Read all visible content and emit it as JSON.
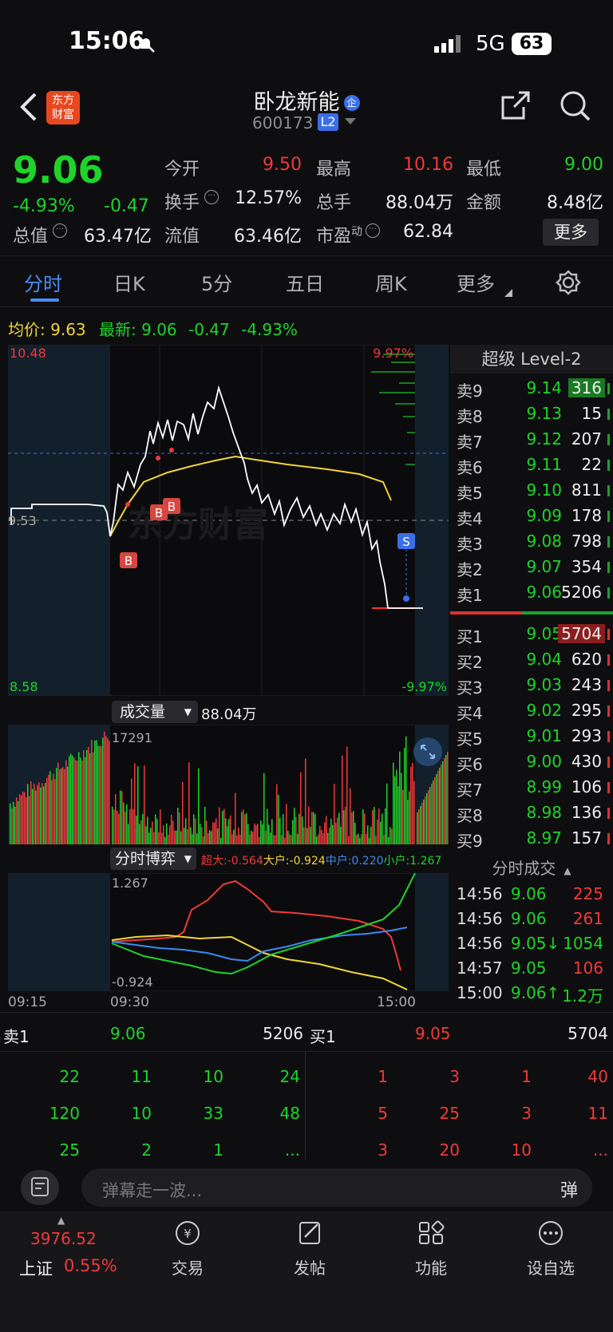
{
  "status_bar": {
    "time": "15:06",
    "network": "5G",
    "battery": "63"
  },
  "header": {
    "stock_name": "卧龙新能",
    "tag": "企",
    "code": "600173",
    "level": "L2",
    "logo_line1": "东方",
    "logo_line2": "财富"
  },
  "quote": {
    "price": "9.06",
    "change_pct": "-4.93%",
    "change": "-0.47",
    "open_label": "今开",
    "open": "9.50",
    "high_label": "最高",
    "high": "10.16",
    "low_label": "最低",
    "low": "9.00",
    "turnover_label": "换手",
    "turnover": "12.57%",
    "volume_label": "总手",
    "volume": "88.04万",
    "amount_label": "金额",
    "amount": "8.48亿",
    "mktcap_label": "总值",
    "mktcap": "63.47亿",
    "float_label": "流值",
    "float_cap": "63.46亿",
    "pe_label": "市盈",
    "pe_sup": "动",
    "pe": "62.84",
    "more_button": "更多"
  },
  "tabs": [
    "分时",
    "日K",
    "5分",
    "五日",
    "周K",
    "更多"
  ],
  "avg_line": {
    "avg_label": "均价:",
    "avg": "9.63",
    "latest_label": "最新:",
    "latest": "9.06",
    "chg": "-0.47",
    "pct": "-4.93%"
  },
  "chart": {
    "y_high": "10.48",
    "y_low": "8.58",
    "pct_high": "9.97%",
    "pct_low": "-9.97%",
    "mid_label": "9.53",
    "watermark": "东方财富",
    "vol_selector": "成交量",
    "vol_total": "88.04万",
    "vol_max": "17291",
    "game_selector": "分时博弈",
    "game_legend": [
      {
        "label": "超大:-0.564",
        "color": "#f0393a"
      },
      {
        "label": "大户:-0.924",
        "color": "#f0d43a"
      },
      {
        "label": "中户:0.220",
        "color": "#3a8af0"
      },
      {
        "label": "小户:1.267",
        "color": "#1ed42a"
      }
    ],
    "game_max": "1.267",
    "game_min": "-0.924",
    "time_labels": [
      "09:15",
      "09:30",
      "15:00"
    ],
    "markers": [
      "B",
      "B",
      "B",
      "S"
    ]
  },
  "level2": {
    "title": "超级 Level-2",
    "asks": [
      {
        "label": "卖9",
        "price": "9.14",
        "vol": "316"
      },
      {
        "label": "卖8",
        "price": "9.13",
        "vol": "15"
      },
      {
        "label": "卖7",
        "price": "9.12",
        "vol": "207"
      },
      {
        "label": "卖6",
        "price": "9.11",
        "vol": "22"
      },
      {
        "label": "卖5",
        "price": "9.10",
        "vol": "811"
      },
      {
        "label": "卖4",
        "price": "9.09",
        "vol": "178"
      },
      {
        "label": "卖3",
        "price": "9.08",
        "vol": "798"
      },
      {
        "label": "卖2",
        "price": "9.07",
        "vol": "354"
      },
      {
        "label": "卖1",
        "price": "9.06",
        "vol": "5206"
      }
    ],
    "bids": [
      {
        "label": "买1",
        "price": "9.05",
        "vol": "5704"
      },
      {
        "label": "买2",
        "price": "9.04",
        "vol": "620"
      },
      {
        "label": "买3",
        "price": "9.03",
        "vol": "243"
      },
      {
        "label": "买4",
        "price": "9.02",
        "vol": "295"
      },
      {
        "label": "买5",
        "price": "9.01",
        "vol": "293"
      },
      {
        "label": "买6",
        "price": "9.00",
        "vol": "430"
      },
      {
        "label": "买7",
        "price": "8.99",
        "vol": "106"
      },
      {
        "label": "买8",
        "price": "8.98",
        "vol": "136"
      },
      {
        "label": "买9",
        "price": "8.97",
        "vol": "157"
      }
    ],
    "trades_title": "分时成交",
    "trades": [
      {
        "time": "14:56",
        "price": "9.06",
        "vol": "225",
        "vcolor": "red"
      },
      {
        "time": "14:56",
        "price": "9.06",
        "vol": "261",
        "vcolor": "red"
      },
      {
        "time": "14:56",
        "price": "9.05↓",
        "vol": "1054",
        "vcolor": "green"
      },
      {
        "time": "14:57",
        "price": "9.05",
        "vol": "106",
        "vcolor": "red"
      },
      {
        "time": "15:00",
        "price": "9.06↑",
        "vol": "1.2万",
        "vcolor": "green"
      }
    ]
  },
  "queue": {
    "ask_label": "卖1",
    "ask_price": "9.06",
    "ask_vol": "5206",
    "bid_label": "买1",
    "bid_price": "9.05",
    "bid_vol": "5704",
    "ask_rows": [
      [
        "22",
        "11",
        "10",
        "24"
      ],
      [
        "120",
        "10",
        "33",
        "48"
      ],
      [
        "25",
        "2",
        "1",
        "..."
      ]
    ],
    "bid_rows": [
      [
        "1",
        "3",
        "1",
        "40"
      ],
      [
        "5",
        "25",
        "3",
        "11"
      ],
      [
        "3",
        "20",
        "10",
        "..."
      ]
    ]
  },
  "danmu": {
    "placeholder": "弹幕走一波...",
    "button": "弹"
  },
  "nav": {
    "index_value": "3976.52",
    "index_name": "上证",
    "index_pct": "0.55%",
    "items": [
      "交易",
      "发帖",
      "功能",
      "设自选"
    ]
  }
}
